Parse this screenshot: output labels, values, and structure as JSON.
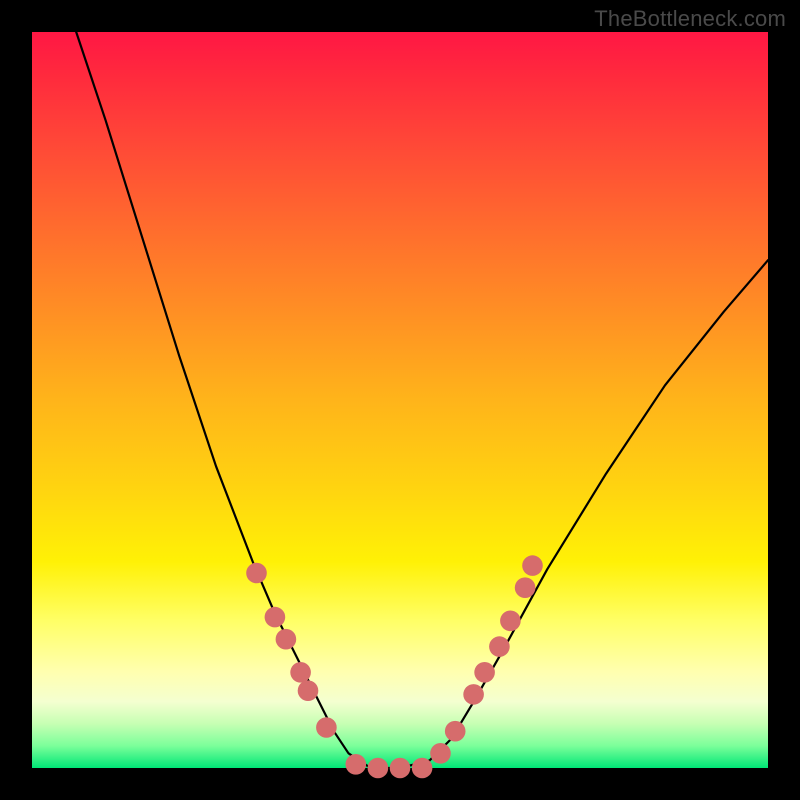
{
  "attribution": "TheBottleneck.com",
  "chart_data": {
    "type": "line",
    "title": "",
    "xlabel": "",
    "ylabel": "",
    "xlim": [
      0,
      1
    ],
    "ylim": [
      0,
      1
    ],
    "background_gradient": {
      "top": "#ff1744",
      "mid": "#ffd410",
      "bottom": "#00e676"
    },
    "series": [
      {
        "name": "bottleneck-curve",
        "color": "#000000",
        "x": [
          0.06,
          0.1,
          0.15,
          0.2,
          0.25,
          0.3,
          0.33,
          0.36,
          0.39,
          0.41,
          0.43,
          0.46,
          0.5,
          0.54,
          0.57,
          0.6,
          0.64,
          0.7,
          0.78,
          0.86,
          0.94,
          1.0
        ],
        "y": [
          1.0,
          0.88,
          0.72,
          0.56,
          0.41,
          0.28,
          0.21,
          0.15,
          0.09,
          0.05,
          0.02,
          0.0,
          0.0,
          0.01,
          0.04,
          0.09,
          0.16,
          0.27,
          0.4,
          0.52,
          0.62,
          0.69
        ]
      }
    ],
    "markers": {
      "color": "#d66c6c",
      "radius_norm": 0.014,
      "points": [
        {
          "x": 0.305,
          "y": 0.265
        },
        {
          "x": 0.33,
          "y": 0.205
        },
        {
          "x": 0.345,
          "y": 0.175
        },
        {
          "x": 0.365,
          "y": 0.13
        },
        {
          "x": 0.375,
          "y": 0.105
        },
        {
          "x": 0.4,
          "y": 0.055
        },
        {
          "x": 0.44,
          "y": 0.005
        },
        {
          "x": 0.47,
          "y": 0.0
        },
        {
          "x": 0.5,
          "y": 0.0
        },
        {
          "x": 0.53,
          "y": 0.0
        },
        {
          "x": 0.555,
          "y": 0.02
        },
        {
          "x": 0.575,
          "y": 0.05
        },
        {
          "x": 0.6,
          "y": 0.1
        },
        {
          "x": 0.615,
          "y": 0.13
        },
        {
          "x": 0.635,
          "y": 0.165
        },
        {
          "x": 0.65,
          "y": 0.2
        },
        {
          "x": 0.67,
          "y": 0.245
        },
        {
          "x": 0.68,
          "y": 0.275
        }
      ]
    }
  }
}
